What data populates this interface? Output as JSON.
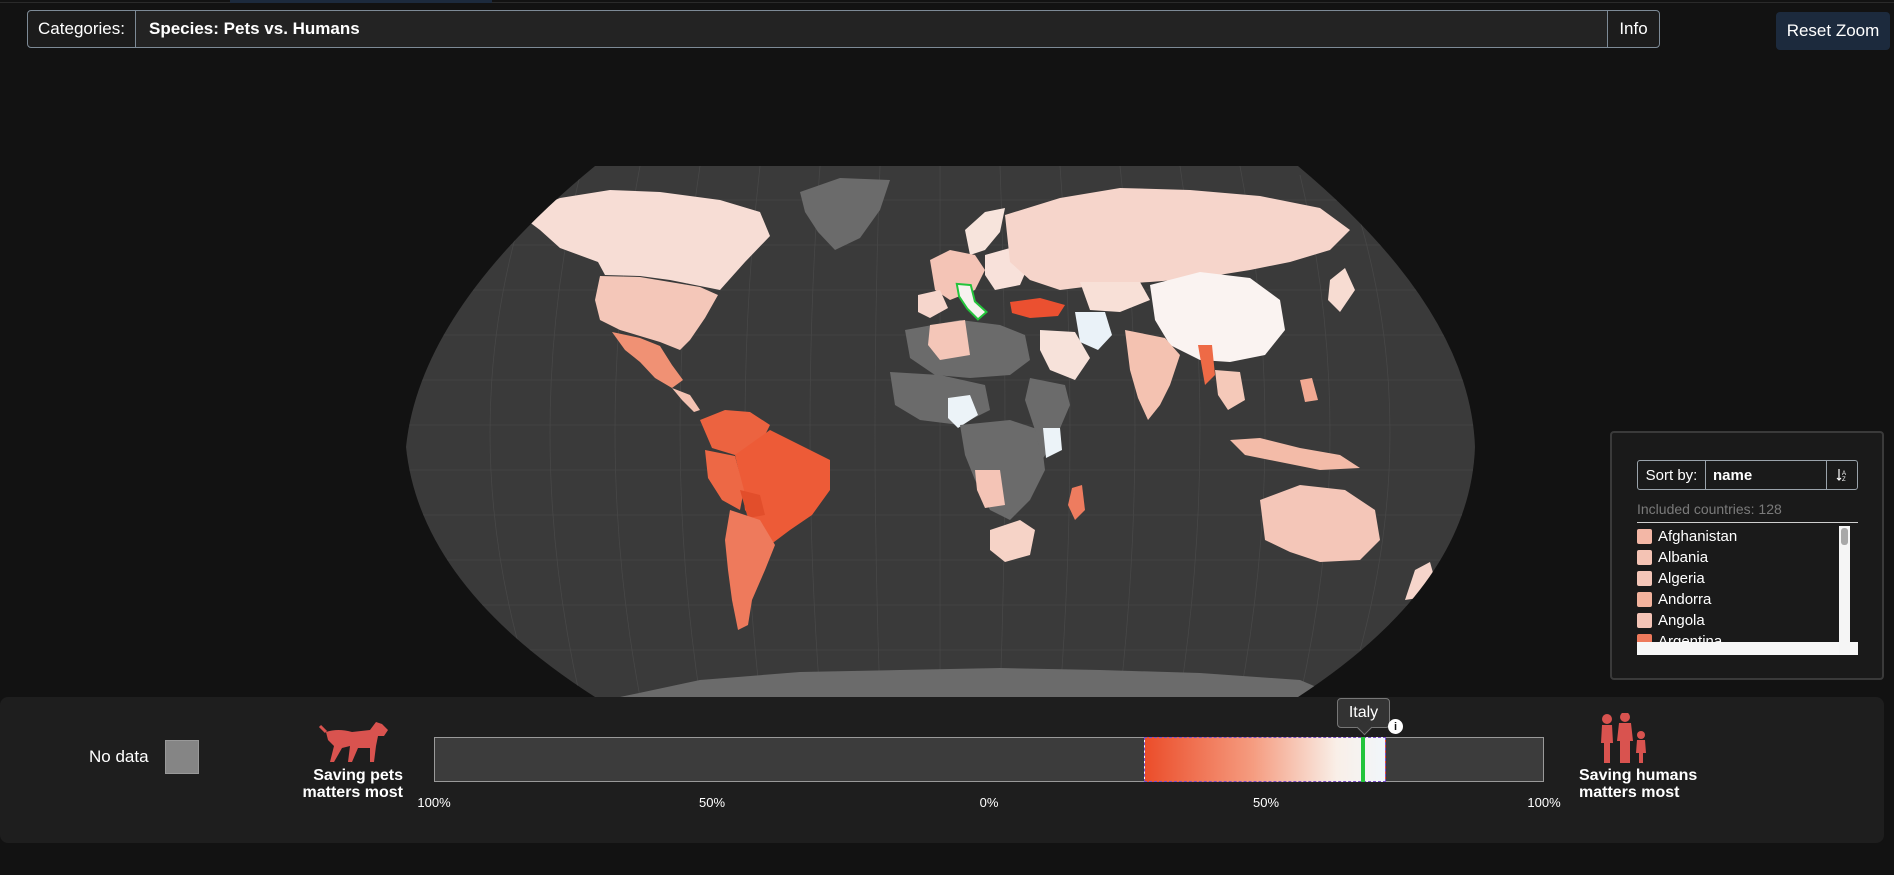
{
  "header": {
    "categories_label": "Categories:",
    "category_value": "Species: Pets vs. Humans",
    "info_label": "Info",
    "reset_zoom_label": "Reset Zoom"
  },
  "map": {
    "highlighted_country": "Italy",
    "no_data_color": "#6b6b6b",
    "ocean_color": "#3a3a3a",
    "highlight_color": "#23c43b"
  },
  "side_panel": {
    "sort_by_label": "Sort by:",
    "sort_value": "name",
    "sort_direction_icon": "sort-ascending-icon",
    "included_label": "Included countries: 128",
    "countries": [
      {
        "name": "Afghanistan",
        "color": "#f3b7a6"
      },
      {
        "name": "Albania",
        "color": "#f4c3b4"
      },
      {
        "name": "Algeria",
        "color": "#f4c6b8"
      },
      {
        "name": "Andorra",
        "color": "#f3b39d"
      },
      {
        "name": "Angola",
        "color": "#f4c4b6"
      },
      {
        "name": "Argentina",
        "color": "#ee7a5c"
      }
    ]
  },
  "legend": {
    "no_data_label": "No data",
    "left_label_line1": "Saving pets",
    "left_label_line2": "matters most",
    "right_label_line1": "Saving humans",
    "right_label_line2": "matters most",
    "ticks": [
      "100%",
      "50%",
      "0%",
      "50%",
      "100%"
    ],
    "tooltip": "Italy",
    "range_start_fraction": 0.22,
    "range_end_fraction": 0.71,
    "marker_fraction": 0.67,
    "gradient_colors": [
      "#eb4d2a",
      "#f59c80",
      "#f9efe8",
      "#f1f6fa"
    ]
  }
}
